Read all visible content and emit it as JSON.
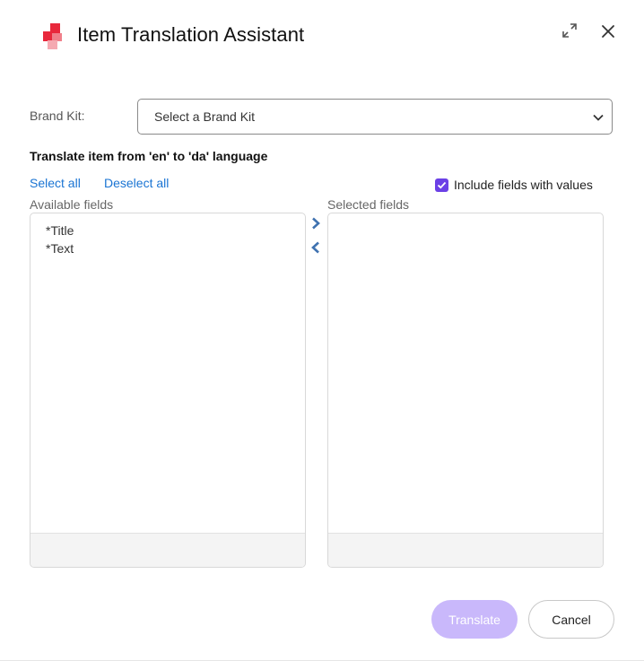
{
  "dialog": {
    "title": "Item Translation Assistant",
    "logo_icon": "brand-logo-icon",
    "maximize_icon": "maximize-icon",
    "close_icon": "close-icon"
  },
  "brand_kit": {
    "label": "Brand Kit:",
    "selected": "Select a Brand Kit",
    "chevron_icon": "chevron-down-icon"
  },
  "heading": "Translate item from 'en' to 'da' language",
  "links": {
    "select_all": "Select all",
    "deselect_all": "Deselect all"
  },
  "include_fields": {
    "label": "Include fields with values",
    "checked": true
  },
  "available": {
    "label": "Available fields",
    "items": [
      "*Title",
      "*Text"
    ]
  },
  "selected": {
    "label": "Selected fields",
    "items": []
  },
  "transfer": {
    "add_icon": "chevron-right-icon",
    "remove_icon": "chevron-left-icon"
  },
  "actions": {
    "translate": "Translate",
    "cancel": "Cancel"
  },
  "colors": {
    "accent": "#6b40e6",
    "translate_disabled": "#c9b8fb",
    "link": "#1a74d3",
    "logo": "#e8283c"
  }
}
